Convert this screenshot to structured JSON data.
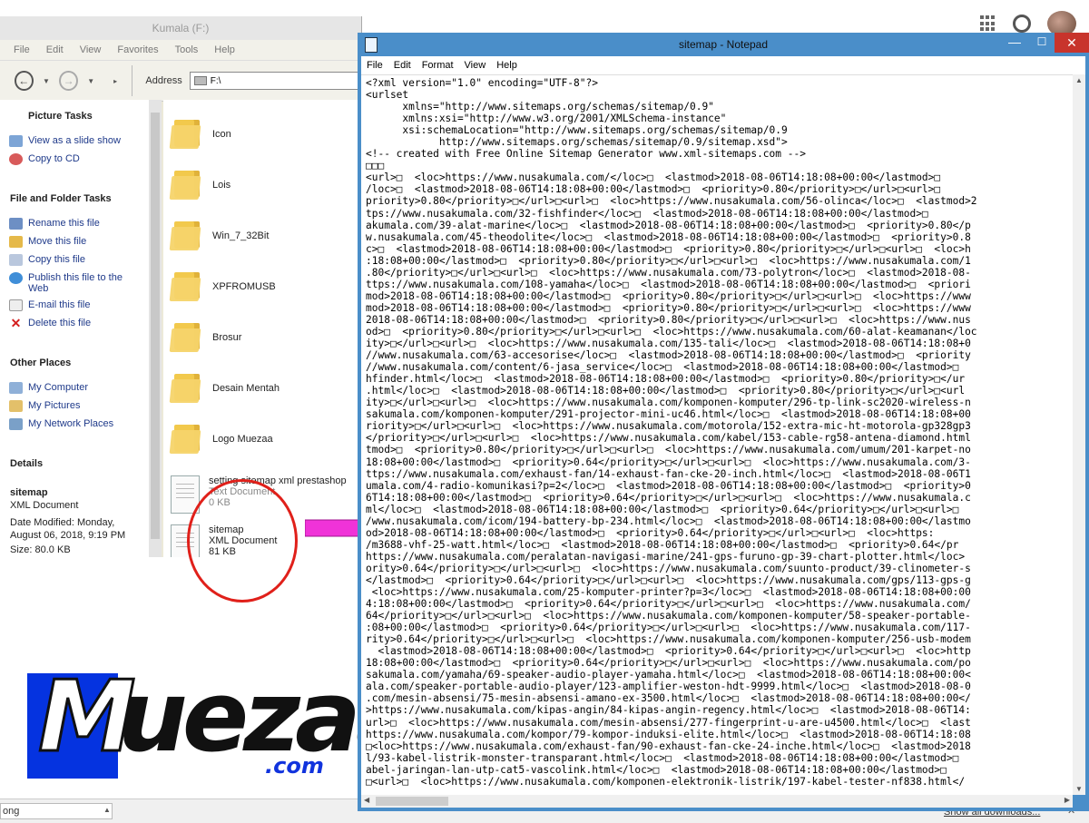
{
  "explorer": {
    "title": "Kumala (F:)",
    "menu": [
      "File",
      "Edit",
      "View",
      "Favorites",
      "Tools",
      "Help"
    ],
    "address_label": "Address",
    "address_value": "F:\\",
    "picture_tasks": {
      "title": "Picture Tasks",
      "items": [
        "View as a slide show",
        "Copy to CD"
      ]
    },
    "file_folder_tasks": {
      "title": "File and Folder Tasks",
      "items": [
        "Rename this file",
        "Move this file",
        "Copy this file",
        "Publish this file to the",
        "Web",
        "E-mail this file",
        "Delete this file"
      ]
    },
    "other_places": {
      "title": "Other Places",
      "items": [
        "My Computer",
        "My Pictures",
        "My Network Places"
      ]
    },
    "details": {
      "title": "Details",
      "name": "sitemap",
      "type": "XML Document",
      "modified_1": "Date Modified: Monday,",
      "modified_2": "August 06, 2018, 9:19 PM",
      "size": "Size: 80.0 KB"
    },
    "folders": [
      "Icon",
      "Lois",
      "Win_7_32Bit",
      "XPFROMUSB",
      "Brosur",
      "Desain Mentah",
      "Logo Muezaa"
    ],
    "files": [
      {
        "name": "setting sitemap xml prestashop",
        "type": "Text Document",
        "size": "0 KB"
      },
      {
        "name": "sitemap",
        "type": "XML Document",
        "size": "81 KB"
      }
    ]
  },
  "notepad": {
    "title": "sitemap - Notepad",
    "menu": [
      "File",
      "Edit",
      "Format",
      "View",
      "Help"
    ],
    "lines": [
      "<?xml version=\"1.0\" encoding=\"UTF-8\"?>",
      "<urlset",
      "      xmlns=\"http://www.sitemaps.org/schemas/sitemap/0.9\"",
      "      xmlns:xsi=\"http://www.w3.org/2001/XMLSchema-instance\"",
      "      xsi:schemaLocation=\"http://www.sitemaps.org/schemas/sitemap/0.9",
      "            http://www.sitemaps.org/schemas/sitemap/0.9/sitemap.xsd\">",
      "<!-- created with Free Online Sitemap Generator www.xml-sitemaps.com -->",
      "□□□",
      "<url>□  <loc>https://www.nusakumala.com/</loc>□  <lastmod>2018-08-06T14:18:08+00:00</lastmod>□",
      "/loc>□  <lastmod>2018-08-06T14:18:08+00:00</lastmod>□  <priority>0.80</priority>□</url>□<url>□",
      "priority>0.80</priority>□</url>□<url>□  <loc>https://www.nusakumala.com/56-olinca</loc>□  <lastmod>2",
      "tps://www.nusakumala.com/32-fishfinder</loc>□  <lastmod>2018-08-06T14:18:08+00:00</lastmod>□",
      "akumala.com/39-alat-marine</loc>□  <lastmod>2018-08-06T14:18:08+00:00</lastmod>□  <priority>0.80</p",
      "w.nusakumala.com/45-theodolite</loc>□  <lastmod>2018-08-06T14:18:08+00:00</lastmod>□  <priority>0.8",
      "c>□  <lastmod>2018-08-06T14:18:08+00:00</lastmod>□  <priority>0.80</priority>□</url>□<url>□  <loc>h",
      ":18:08+00:00</lastmod>□  <priority>0.80</priority>□</url>□<url>□  <loc>https://www.nusakumala.com/1",
      ".80</priority>□</url>□<url>□  <loc>https://www.nusakumala.com/73-polytron</loc>□  <lastmod>2018-08-",
      "ttps://www.nusakumala.com/108-yamaha</loc>□  <lastmod>2018-08-06T14:18:08+00:00</lastmod>□  <priori",
      "mod>2018-08-06T14:18:08+00:00</lastmod>□  <priority>0.80</priority>□</url>□<url>□  <loc>https://www",
      "mod>2018-08-06T14:18:08+00:00</lastmod>□  <priority>0.80</priority>□</url>□<url>□  <loc>https://www",
      "2018-08-06T14:18:08+00:00</lastmod>□  <priority>0.80</priority>□</url>□<url>□  <loc>https://www.nus",
      "od>□  <priority>0.80</priority>□</url>□<url>□  <loc>https://www.nusakumala.com/60-alat-keamanan</loc",
      "ity>□</url>□<url>□  <loc>https://www.nusakumala.com/135-tali</loc>□  <lastmod>2018-08-06T14:18:08+0",
      "//www.nusakumala.com/63-accesorise</loc>□  <lastmod>2018-08-06T14:18:08+00:00</lastmod>□  <priority",
      "//www.nusakumala.com/content/6-jasa_service</loc>□  <lastmod>2018-08-06T14:18:08+00:00</lastmod>□",
      "hfinder.html</loc>□  <lastmod>2018-08-06T14:18:08+00:00</lastmod>□  <priority>0.80</priority>□</ur",
      ".html</loc>□  <lastmod>2018-08-06T14:18:08+00:00</lastmod>□  <priority>0.80</priority>□</url>□<url",
      "ity>□</url>□<url>□  <loc>https://www.nusakumala.com/komponen-komputer/296-tp-link-sc2020-wireless-n",
      "sakumala.com/komponen-komputer/291-projector-mini-uc46.html</loc>□  <lastmod>2018-08-06T14:18:08+00",
      "riority>□</url>□<url>□  <loc>https://www.nusakumala.com/motorola/152-extra-mic-ht-motorola-gp328gp3",
      "</priority>□</url>□<url>□  <loc>https://www.nusakumala.com/kabel/153-cable-rg58-antena-diamond.html",
      "tmod>□  <priority>0.80</priority>□</url>□<url>□  <loc>https://www.nusakumala.com/umum/201-karpet-no",
      "18:08+00:00</lastmod>□  <priority>0.64</priority>□</url>□<url>□  <loc>https://www.nusakumala.com/3-",
      "ttps://www.nusakumala.com/exhaust-fan/14-exhaust-fan-cke-20-inch.html</loc>□  <lastmod>2018-08-06T1",
      "umala.com/4-radio-komunikasi?p=2</loc>□  <lastmod>2018-08-06T14:18:08+00:00</lastmod>□  <priority>0",
      "6T14:18:08+00:00</lastmod>□  <priority>0.64</priority>□</url>□<url>□  <loc>https://www.nusakumala.c",
      "ml</loc>□  <lastmod>2018-08-06T14:18:08+00:00</lastmod>□  <priority>0.64</priority>□</url>□<url>□",
      "/www.nusakumala.com/icom/194-battery-bp-234.html</loc>□  <lastmod>2018-08-06T14:18:08+00:00</lastmo",
      "od>2018-08-06T14:18:08+00:00</lastmod>□  <priority>0.64</priority>□</url>□<url>□  <loc>https:",
      "/m3688-vhf-25-watt.html</loc>□  <lastmod>2018-08-06T14:18:08+00:00</lastmod>□  <priority>0.64</pr",
      "https://www.nusakumala.com/peralatan-navigasi-marine/241-gps-furuno-gp-39-chart-plotter.html</loc>",
      "ority>0.64</priority>□</url>□<url>□  <loc>https://www.nusakumala.com/suunto-product/39-clinometer-s",
      "</lastmod>□  <priority>0.64</priority>□</url>□<url>□  <loc>https://www.nusakumala.com/gps/113-gps-g",
      " <loc>https://www.nusakumala.com/25-komputer-printer?p=3</loc>□  <lastmod>2018-08-06T14:18:08+00:00",
      "4:18:08+00:00</lastmod>□  <priority>0.64</priority>□</url>□<url>□  <loc>https://www.nusakumala.com/",
      "64</priority>□</url>□<url>□  <loc>https://www.nusakumala.com/komponen-komputer/58-speaker-portable-",
      ":08+00:00</lastmod>□  <priority>0.64</priority>□</url>□<url>□  <loc>https://www.nusakumala.com/117-",
      "rity>0.64</priority>□</url>□<url>□  <loc>https://www.nusakumala.com/komponen-komputer/256-usb-modem",
      "  <lastmod>2018-08-06T14:18:08+00:00</lastmod>□  <priority>0.64</priority>□</url>□<url>□  <loc>http",
      "18:08+00:00</lastmod>□  <priority>0.64</priority>□</url>□<url>□  <loc>https://www.nusakumala.com/po",
      "sakumala.com/yamaha/69-speaker-audio-player-yamaha.html</loc>□  <lastmod>2018-08-06T14:18:08+00:00<",
      "ala.com/speaker-portable-audio-player/123-amplifier-weston-hdt-9999.html</loc>□  <lastmod>2018-08-0",
      ".com/mesin-absensi/75-mesin-absensi-amano-ex-3500.html</loc>□  <lastmod>2018-08-06T14:18:08+00:00</",
      ">https://www.nusakumala.com/kipas-angin/84-kipas-angin-regency.html</loc>□  <lastmod>2018-08-06T14:",
      "url>□  <loc>https://www.nusakumala.com/mesin-absensi/277-fingerprint-u-are-u4500.html</loc>□  <last",
      "https://www.nusakumala.com/kompor/79-kompor-induksi-elite.html</loc>□  <lastmod>2018-08-06T14:18:08",
      "□<loc>https://www.nusakumala.com/exhaust-fan/90-exhaust-fan-cke-24-inche.html</loc>□  <lastmod>2018",
      "l/93-kabel-listrik-monster-transparant.html</loc>□  <lastmod>2018-08-06T14:18:08+00:00</lastmod>□",
      "abel-jaringan-lan-utp-cat5-vascolink.html</loc>□  <lastmod>2018-08-06T14:18:08+00:00</lastmod>□",
      "□<url>□  <loc>https://www.nusakumala.com/komponen-elektronik-listrik/197-kabel-tester-nf838.html</"
    ]
  },
  "logo": {
    "main": "Muezaa",
    "first_letter": "M",
    "rest": "uezaa",
    "suffix": ".com",
    "bg_color": "#0533e0"
  },
  "browser_bottom": {
    "left_tab": "ong",
    "show_all": "Show all downloads...",
    "close": "✕"
  },
  "colors": {
    "arrow": "#f033d8",
    "circle": "#e0201a",
    "notepad_frame": "#4a8ec9"
  }
}
